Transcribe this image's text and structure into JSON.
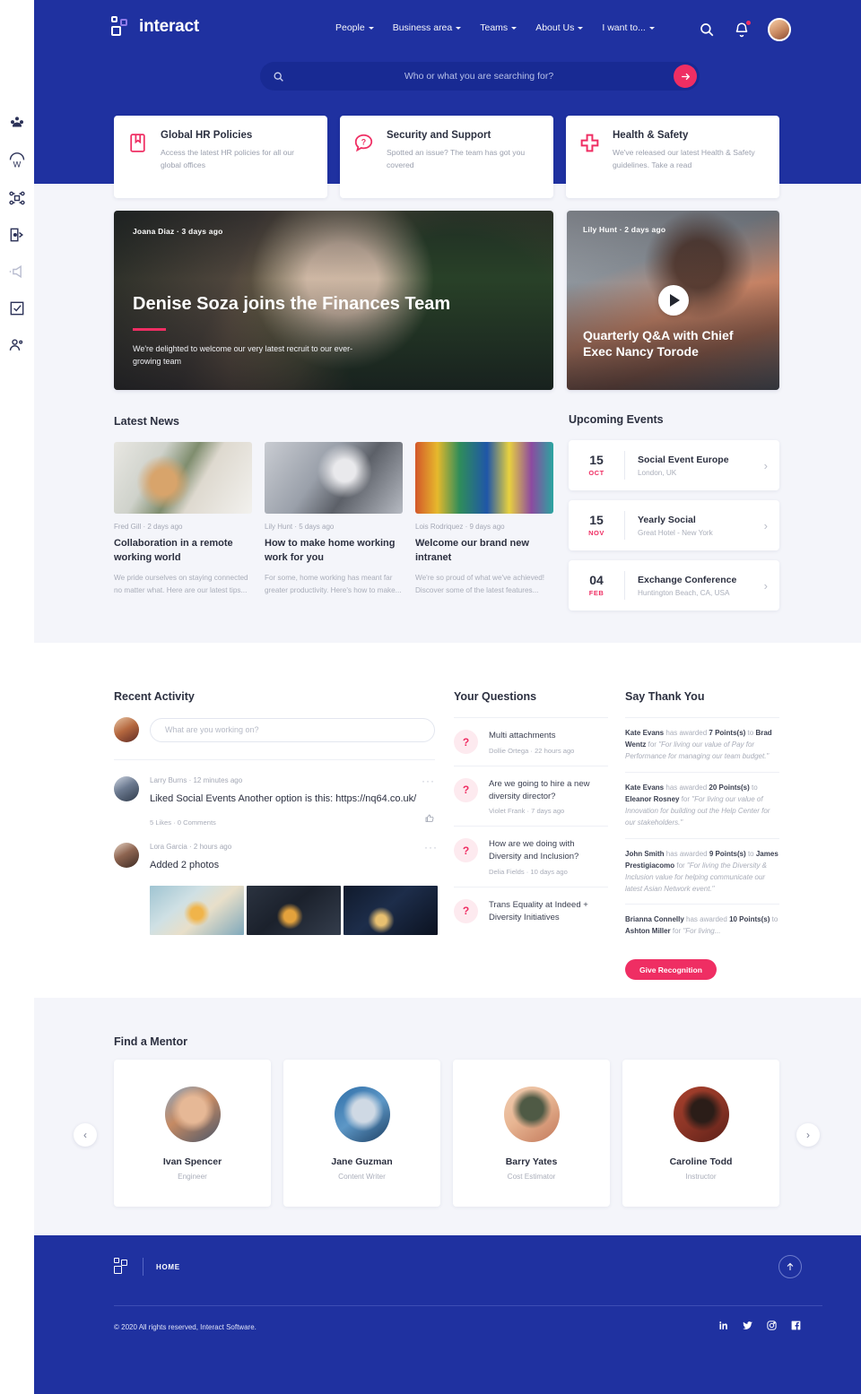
{
  "brand": {
    "name": "interact",
    "mark": "interact-logo"
  },
  "nav": {
    "items": [
      {
        "label": "People"
      },
      {
        "label": "Business area"
      },
      {
        "label": "Teams"
      },
      {
        "label": "About Us"
      },
      {
        "label": "I want to..."
      }
    ]
  },
  "header": {
    "search": {
      "value": "",
      "placeholder": "Who or what you are searching for?"
    },
    "icons": {
      "search": "search-icon",
      "notifications": "bell-icon",
      "avatar": "user-avatar"
    },
    "accent": "#ef2e63",
    "brand_blue": "#1f31a0"
  },
  "sidebar": {
    "items": [
      {
        "icon": "people-group-icon"
      },
      {
        "icon": "umbrella-w-icon"
      },
      {
        "icon": "org-chart-icon"
      },
      {
        "icon": "exit-door-icon"
      },
      {
        "icon": "megaphone-icon"
      },
      {
        "icon": "checklist-icon"
      },
      {
        "icon": "user-pair-icon"
      }
    ]
  },
  "quick_links": [
    {
      "icon": "bookmark-book-icon",
      "title": "Global HR Policies",
      "desc": "Access the latest HR policies for all our global offices"
    },
    {
      "icon": "question-chat-icon",
      "title": "Security and Support",
      "desc": "Spotted an issue? The team has got you covered"
    },
    {
      "icon": "medical-cross-icon",
      "title": "Health & Safety",
      "desc": "We've released our latest Health & Safety guidelines. Take a read"
    }
  ],
  "hero": {
    "featured": {
      "author": "Joana Diaz",
      "time": "3 days ago",
      "meta": "Joana Diaz · 3 days ago",
      "title": "Denise Soza joins the Finances Team",
      "subtitle": "We're delighted to welcome our very latest recruit to our ever-growing team"
    },
    "video": {
      "author": "Lily Hunt",
      "time": "2 days ago",
      "meta": "Lily Hunt · 2 days ago",
      "title": "Quarterly Q&A with Chief Exec Nancy Torode",
      "play": "play-icon"
    }
  },
  "news": {
    "title": "Latest News",
    "items": [
      {
        "author": "Fred Gill",
        "time": "2 days ago",
        "meta": "Fred Gill  ·  2 days ago",
        "title": "Collaboration in a remote working world",
        "desc": "We pride ourselves on staying connected no matter what. Here are our latest tips..."
      },
      {
        "author": "Lily Hunt",
        "time": "5 days ago",
        "meta": "Lily Hunt  ·  5 days ago",
        "title": "How to make home working work for you",
        "desc": "For some, home working has meant far greater productivity. Here's how to make..."
      },
      {
        "author": "Lois Rodriquez",
        "time": "9 days ago",
        "meta": "Lois Rodriquez  ·  9 days ago",
        "title": "Welcome our brand new intranet",
        "desc": "We're so proud of what we've achieved! Discover some of the latest features..."
      }
    ]
  },
  "events": {
    "title": "Upcoming Events",
    "items": [
      {
        "day": "15",
        "month": "OCT",
        "name": "Social Event Europe",
        "location": "London, UK"
      },
      {
        "day": "15",
        "month": "NOV",
        "name": "Yearly Social",
        "location": "Great  Hotel - New York"
      },
      {
        "day": "04",
        "month": "FEB",
        "name": "Exchange Conference",
        "location": "Huntington Beach, CA, USA"
      }
    ]
  },
  "activity": {
    "title": "Recent Activity",
    "composer": {
      "value": "",
      "placeholder": "What are you working on?"
    },
    "posts": [
      {
        "author": "Larry Burns",
        "time": "12 minutes ago",
        "meta": "Larry Burns  ·  12 minutes ago",
        "text": "Liked Social Events Another option is this: https://nq64.co.uk/",
        "stats": "5 Likes  ·  0 Comments"
      },
      {
        "author": "Lora Garcia",
        "time": "2 hours ago",
        "meta": "Lora Garcia  ·  2 hours ago",
        "text": "Added 2 photos"
      }
    ]
  },
  "questions": {
    "title": "Your Questions",
    "items": [
      {
        "title": "Multi attachments",
        "author": "Dollie Ortega",
        "time": "22 hours ago",
        "meta": "Dollie Ortega  ·  22 hours ago"
      },
      {
        "title": "Are we going to hire a new diversity director?",
        "author": "Violet Frank",
        "time": "7 days ago",
        "meta": "Violet Frank  ·  7 days ago"
      },
      {
        "title": "How are we doing with Diversity and Inclusion?",
        "author": "Delia Fields",
        "time": "10 days ago",
        "meta": "Delia Fields  ·  10 days ago"
      },
      {
        "title": "Trans Equality at Indeed + Diversity Initiatives",
        "author": "",
        "time": "",
        "meta": ""
      }
    ]
  },
  "thanks": {
    "title": "Say Thank You",
    "button": "Give Recognition",
    "items": [
      {
        "giver": "Kate Evans",
        "points": "7 Points(s)",
        "receiver": "Brad Wentz",
        "reason": "\"For living our value of Pay for Performance for managing our team budget.\""
      },
      {
        "giver": "Kate Evans",
        "points": "20 Points(s)",
        "receiver": "Eleanor Rosney",
        "reason": "\"For living our value of Innovation for building out the Help Center for our stakeholders.\""
      },
      {
        "giver": "John Smith",
        "points": "9 Points(s)",
        "receiver": "James Prestigiacomo",
        "reason": "\"For living the Diversity & Inclusion value for helping communicate our latest Asian Network event.\""
      },
      {
        "giver": "Brianna Connelly",
        "points": "10 Points(s)",
        "receiver": "Ashton Miller",
        "reason": "\"For living..."
      }
    ],
    "connector_awarded": " has awarded ",
    "connector_to": " to ",
    "connector_for": " for "
  },
  "mentors": {
    "title": "Find a Mentor",
    "prev": "chevron-left-icon",
    "next": "chevron-right-icon",
    "items": [
      {
        "name": "Ivan Spencer",
        "role": "Engineer"
      },
      {
        "name": "Jane Guzman",
        "role": "Content Writer"
      },
      {
        "name": "Barry Yates",
        "role": "Cost Estimator"
      },
      {
        "name": "Caroline Todd",
        "role": "Instructor"
      }
    ]
  },
  "footer": {
    "home_label": "HOME",
    "copyright": "© 2020 All rights reserved,  Interact Software.",
    "back_to_top": "arrow-up-icon",
    "social": [
      "linkedin-icon",
      "twitter-icon",
      "instagram-icon",
      "facebook-icon"
    ]
  }
}
